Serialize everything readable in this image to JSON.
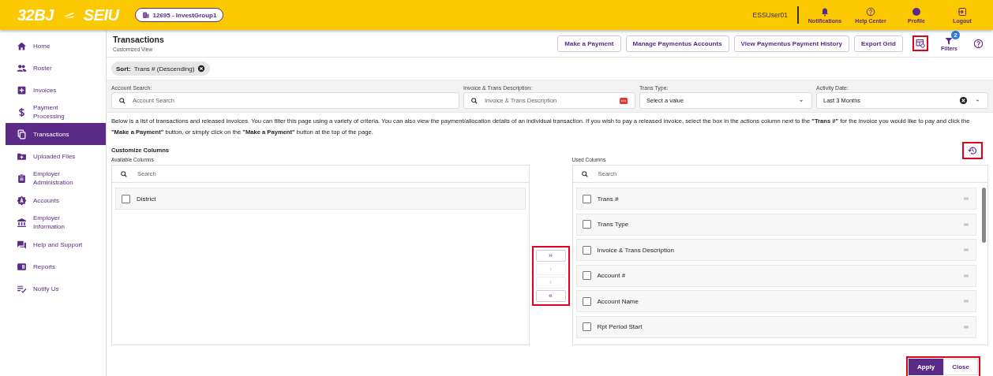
{
  "header": {
    "logo_left": "32BJ",
    "logo_right": "SEIU",
    "group_chip": "12695 - InvestGroup1",
    "user": "ESSUser01",
    "actions": [
      {
        "label": "Notifications"
      },
      {
        "label": "Help Center"
      },
      {
        "label": "Profile"
      },
      {
        "label": "Logout"
      }
    ]
  },
  "sidebar": {
    "items": [
      {
        "label": "Home",
        "selected": false
      },
      {
        "label": "Roster",
        "selected": false
      },
      {
        "label": "Invoices",
        "selected": false
      },
      {
        "label": "Payment Processing",
        "selected": false
      },
      {
        "label": "Transactions",
        "selected": true
      },
      {
        "label": "Uploaded Files",
        "selected": false
      },
      {
        "label": "Employer Administration",
        "selected": false
      },
      {
        "label": "Accounts",
        "selected": false
      },
      {
        "label": "Employer Information",
        "selected": false
      },
      {
        "label": "Help and Support",
        "selected": false
      },
      {
        "label": "Reports",
        "selected": false
      },
      {
        "label": "Notify Us",
        "selected": false
      }
    ]
  },
  "page": {
    "title": "Transactions",
    "subtitle": "Customized View",
    "buttons": [
      "Make a Payment",
      "Manage Paymentus Accounts",
      "View Paymentus Payment History",
      "Export Grid"
    ],
    "tools": [
      {
        "kind": "grid-settings",
        "highlighted": true
      },
      {
        "kind": "filters",
        "label": "Filters",
        "badge": "2",
        "highlighted": false
      },
      {
        "kind": "help",
        "highlighted": false
      }
    ]
  },
  "sort_chip": {
    "label": "Sort:",
    "value": "Trans # (Descending)"
  },
  "filters": [
    {
      "kind": "search",
      "label": "Account Search:",
      "placeholder": "Account Search"
    },
    {
      "kind": "search-more",
      "label": "Invoice & Trans Description:",
      "placeholder": "Invoice & Trans Description"
    },
    {
      "kind": "select",
      "label": "Trans Type:",
      "placeholder": "Select a value"
    },
    {
      "kind": "select-clear",
      "label": "Activity Date:",
      "value": "Last 3 Months"
    }
  ],
  "description": "Below is a list of transactions and released invoices. You can filter this page using a variety of criteria. You can also view the payment/allocation details of an individual transaction. If you wish to pay a released invoice, select the box in the actions column next to the **\"Trans #\"** for the invoice you would like to pay and click the **\"Make a Payment\"** button, or simply click on the **\"Make a Payment\"** button at the top of the page.",
  "customize": {
    "title": "Customize Columns",
    "reset_highlighted": true,
    "available": {
      "label": "Available Columns",
      "search_placeholder": "Search",
      "items": [
        {
          "label": "District",
          "checked": false
        }
      ]
    },
    "transfer": {
      "highlighted": true,
      "buttons": [
        {
          "label": "»",
          "disabled": false
        },
        {
          "label": "›",
          "disabled": true
        },
        {
          "label": "‹",
          "disabled": true
        },
        {
          "label": "«",
          "disabled": false
        }
      ]
    },
    "used": {
      "label": "Used Columns",
      "search_placeholder": "Search",
      "items": [
        {
          "label": "Trans #",
          "checked": false
        },
        {
          "label": "Trans Type",
          "checked": false
        },
        {
          "label": "Invoice & Trans Description",
          "checked": false
        },
        {
          "label": "Account #",
          "checked": false
        },
        {
          "label": "Account Name",
          "checked": false
        },
        {
          "label": "Rpt Period Start",
          "checked": false
        }
      ]
    },
    "footer": {
      "highlighted": true,
      "buttons": [
        {
          "label": "Apply",
          "kind": "primary"
        },
        {
          "label": "Close",
          "kind": "secondary"
        }
      ]
    }
  }
}
